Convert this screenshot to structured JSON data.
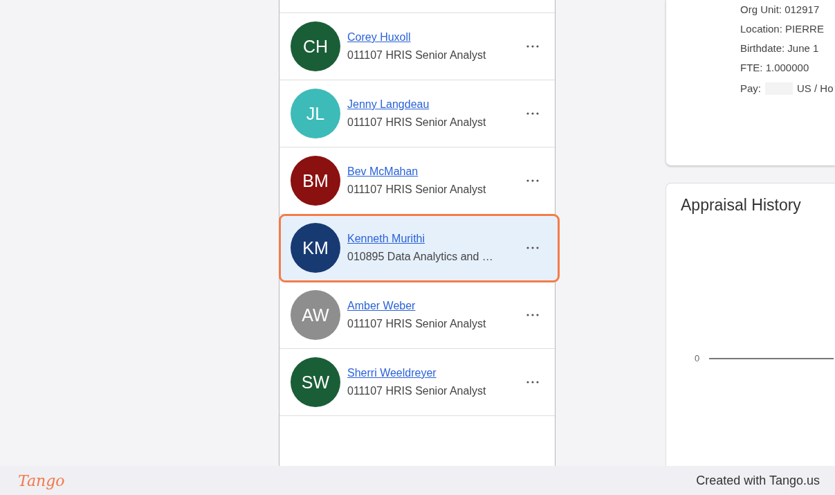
{
  "people": [
    {
      "initials": "CH",
      "name": "Corey Huxoll",
      "position": "011107 HRIS Senior Analyst",
      "color": "#1a5e37",
      "selected": false
    },
    {
      "initials": "JL",
      "name": "Jenny Langdeau",
      "position": "011107 HRIS Senior Analyst",
      "color": "#3dbbb8",
      "selected": false
    },
    {
      "initials": "BM",
      "name": "Bev McMahan",
      "position": "011107 HRIS Senior Analyst",
      "color": "#8b1010",
      "selected": false
    },
    {
      "initials": "KM",
      "name": "Kenneth Murithi",
      "position": "010895 Data Analytics and …",
      "color": "#173a73",
      "selected": true
    },
    {
      "initials": "AW",
      "name": "Amber Weber",
      "position": "011107 HRIS Senior Analyst",
      "color": "#8e8e8e",
      "selected": false
    },
    {
      "initials": "SW",
      "name": "Sherri Weeldreyer",
      "position": "011107 HRIS Senior Analyst",
      "color": "#1a5e37",
      "selected": false
    }
  ],
  "details": {
    "lines": [
      "Org Unit: 012917",
      "Location: PIERRE",
      "Birthdate: June 1",
      "FTE: 1.000000"
    ],
    "pay_label": "Pay:",
    "pay_value": "US / Ho"
  },
  "appraisal": {
    "title": "Appraisal History",
    "axis_label": "0"
  },
  "footer": {
    "logo": "Tango",
    "credit": "Created with Tango.us"
  }
}
